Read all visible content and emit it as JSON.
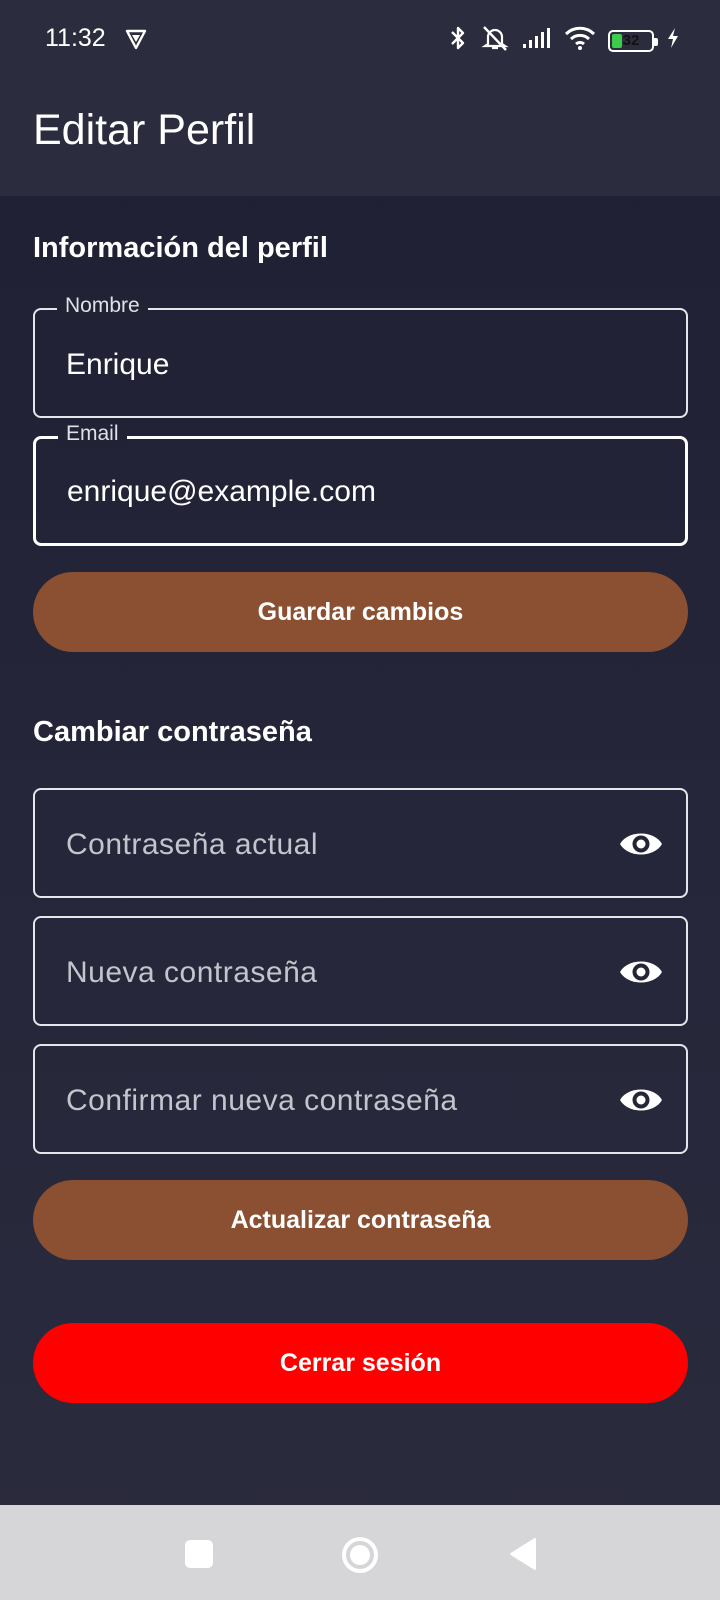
{
  "status_bar": {
    "time": "11:32",
    "battery_level": "32",
    "icons": [
      "shield-icon",
      "bluetooth-icon",
      "alarm-off-icon",
      "signal-icon",
      "wifi-icon",
      "battery-icon",
      "charging-icon"
    ]
  },
  "app_bar": {
    "title": "Editar Perfil"
  },
  "profile": {
    "section_title": "Información del perfil",
    "name_label": "Nombre",
    "name_value": "Enrique",
    "email_label": "Email",
    "email_value": "enrique@example.com",
    "save_label": "Guardar cambios"
  },
  "password": {
    "section_title": "Cambiar contraseña",
    "current_placeholder": "Contraseña actual",
    "new_placeholder": "Nueva contraseña",
    "confirm_placeholder": "Confirmar nueva contraseña",
    "update_label": "Actualizar contraseña"
  },
  "logout_label": "Cerrar sesión",
  "colors": {
    "primary_button": "#8b4f31",
    "danger_button": "#fe0000",
    "background": "#26273a",
    "battery_green": "#3bcc4a"
  },
  "battery_fraction": 0.32,
  "nav_bar": {
    "icons": [
      "recents-square-icon",
      "home-circle-icon",
      "back-triangle-icon"
    ]
  }
}
